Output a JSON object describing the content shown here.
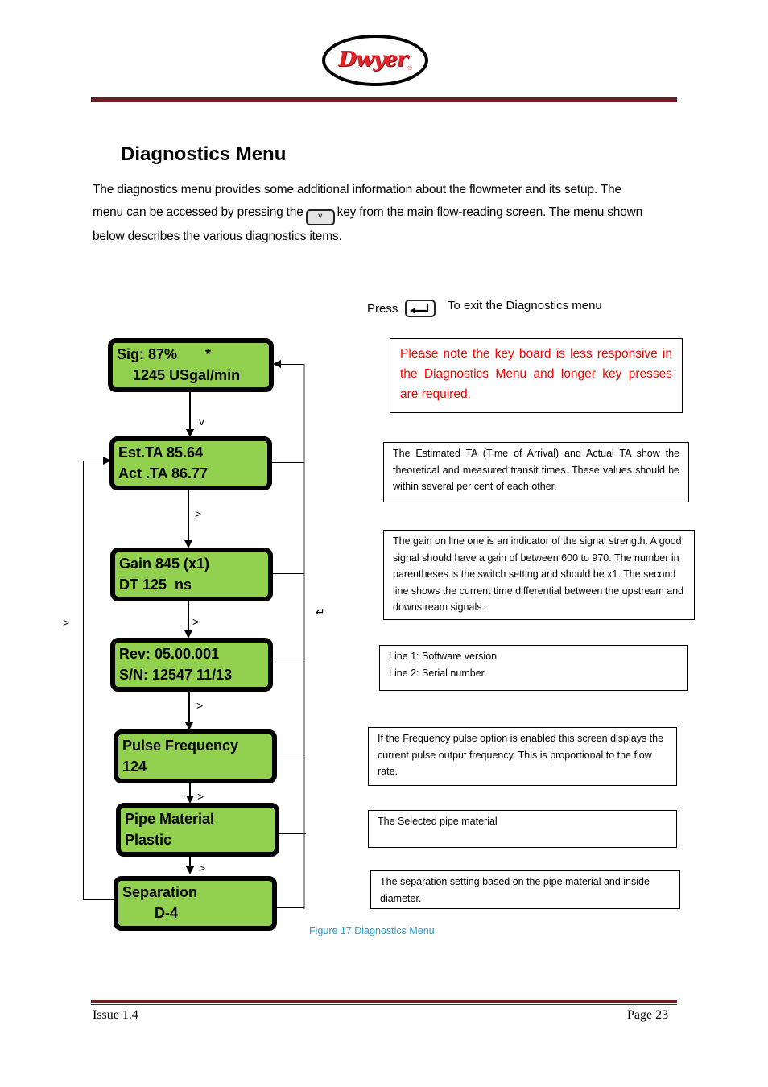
{
  "header": {
    "logo_text": "Dwyer",
    "logo_registered": "®"
  },
  "section": {
    "title": "Diagnostics Menu",
    "intro_line1": "The diagnostics menu provides some additional information about the flowmeter and its setup. The",
    "intro_line2_before": "menu can be accessed by pressing the",
    "intro_key_label": "v",
    "intro_line2_after": "key from the main flow-reading screen. The menu shown",
    "intro_line3": "below describes the various diagnostics items."
  },
  "exit_hint": {
    "press_label": "Press",
    "key_icon": "enter-key-icon",
    "text": "To exit the Diagnostics menu"
  },
  "note": {
    "text": "Please note the key board is less responsive in the Diagnostics Menu and longer key presses are required.",
    "color": "#ff0000"
  },
  "screens": [
    {
      "line1": "Sig: 87%       *",
      "line2": "    1245 USgal/min"
    },
    {
      "line1": "Est.TA 85.64",
      "line2": "Act .TA 86.77"
    },
    {
      "line1": "Gain 845 (x1)",
      "line2": "DT 125  ns"
    },
    {
      "line1": "Rev: 05.00.001",
      "line2": "S/N: 12547 11/13"
    },
    {
      "line1": "Pulse Frequency",
      "line2": "124"
    },
    {
      "line1": "Pipe Material",
      "line2": "Plastic"
    },
    {
      "line1": "Separation",
      "line2": "        D-4"
    }
  ],
  "lcd_color": "#92d050",
  "flow_labels": {
    "down_key": "v",
    "next_key": ">",
    "wrap_key": ">",
    "return_key": "↵"
  },
  "descriptions": [
    "The Estimated TA (Time of Arrival) and Actual TA show the theoretical and measured transit times. These values should be within several per cent of each other.",
    "The gain on line one is an indicator of the signal strength. A good signal should have a gain of between 600 to 970. The number in parentheses is the switch setting and should be x1. The second line shows the current time differential between  the upstream and downstream signals.",
    "Line 1:  Software version\nLine 2:  Serial number.",
    "If the Frequency pulse option is enabled this screen displays the current pulse output frequency. This is proportional to the flow rate.",
    "The Selected pipe material",
    "The separation setting based on the pipe material and inside diameter."
  ],
  "figure_caption": "Figure 17 Diagnostics Menu",
  "caption_color": "#1aa0d8",
  "footer": {
    "issue": "Issue 1.4",
    "page": "Page 23"
  }
}
